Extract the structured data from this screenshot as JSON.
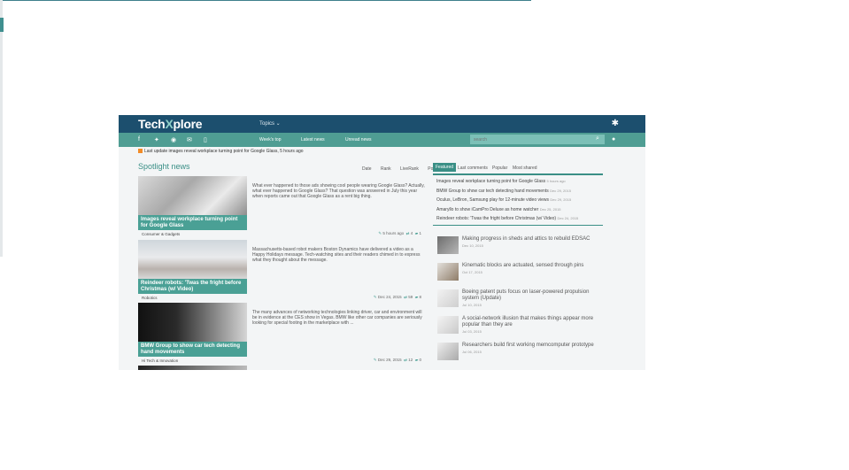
{
  "header": {
    "logo_a": "Tech",
    "logo_x": "X",
    "logo_b": "plore",
    "topics": "Topics ⌄"
  },
  "nav": {
    "links": [
      "Week's top",
      "Latest news",
      "Unread news"
    ],
    "search_placeholder": "search"
  },
  "last_update": "Last update images reveal workplace turning point for Google Glass, 5 hours ago",
  "spotlight": {
    "title": "Spotlight news",
    "tabs": [
      "Date",
      "Rank",
      "LiveRank",
      "Popular"
    ],
    "articles": [
      {
        "caption": "Images reveal workplace turning point for Google Glass",
        "blurb": "What ever happened to those ads showing cool people wearing Google Glass? Actually, what ever happened to Google Glass? That question was answered in July this year when reports came out that Google Glass as a rent big thing.",
        "category": "Consumer & Gadgets",
        "time": "5 hours ago",
        "shares": "4",
        "comments": "1"
      },
      {
        "caption": "Reindeer robots: 'Twas the fright before Christmas (w/ Video)",
        "blurb": "Massachusetts-based robot makers Boston Dynamics have delivered a video as a Happy Holidays message. Tech-watching sites and their readers chimed in to express what they thought about the message.",
        "category": "Robotics",
        "time": "Dec 24, 2015",
        "shares": "59",
        "comments": "8"
      },
      {
        "caption": "BMW Group to show car tech detecting hand movements",
        "blurb": "The many advances of networking technologies linking driver, car and environment will be in evidence at the CES show in Vegas. BMW like other car companies are seriously looking for special footing in the marketplace with ...",
        "category": "Hi Tech & Innovation",
        "time": "Dec 29, 2015",
        "shares": "12",
        "comments": "0"
      }
    ]
  },
  "right": {
    "tabs": [
      "Featured",
      "Last comments",
      "Popular",
      "Most shared"
    ],
    "list": [
      {
        "title": "Images reveal workplace turning point for Google Glass",
        "time": "5 hours ago"
      },
      {
        "title": "BMW Group to show car tech detecting hand movements",
        "time": "Dec 29, 2015"
      },
      {
        "title": "Oculus, LeBron, Samsung play for 12-minute video views",
        "time": "Dec 29, 2015"
      },
      {
        "title": "Amaryllo to show iCamPro Deluxe as home watcher",
        "time": "Dec 25, 2015"
      },
      {
        "title": "Reindeer robots: 'Twas the fright before Christmas (w/ Video)",
        "time": "Dec 24, 2015"
      }
    ],
    "items": [
      {
        "title": "Making progress in sheds and attics to rebuild EDSAC",
        "date": "Dec 10, 2015"
      },
      {
        "title": "Kinematic blocks are actuated, sensed through pins",
        "date": "Oct 17, 2015"
      },
      {
        "title": "Boeing patent puts focus on laser-powered propulsion system (Update)",
        "date": "Jul 10, 2015"
      },
      {
        "title": "A social-network illusion that makes things appear more popular than they are",
        "date": "Jul 03, 2015"
      },
      {
        "title": "Researchers build first working memcomputer prototype",
        "date": "Jul 06, 2015"
      }
    ]
  },
  "colors": {
    "header": "#1c4f6e",
    "nav": "#4f9d93",
    "accent": "#3a8f86"
  }
}
